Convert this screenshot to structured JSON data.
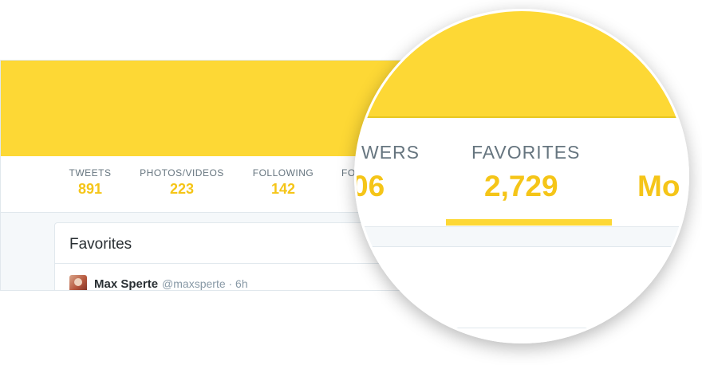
{
  "colors": {
    "banner": "#fdd835",
    "accent_value": "#f5c518",
    "label": "#66757f",
    "background": "#f5f8fa",
    "border": "#e1e8ed"
  },
  "profile_nav": {
    "items": [
      {
        "label": "TWEETS",
        "value": "891"
      },
      {
        "label": "PHOTOS/VIDEOS",
        "value": "223"
      },
      {
        "label": "FOLLOWING",
        "value": "142"
      },
      {
        "label": "FO",
        "value": ""
      }
    ]
  },
  "favorites_card": {
    "title": "Favorites",
    "tweet": {
      "avatar_icon": "user-avatar",
      "name": "Max Sperte",
      "meta": "@maxsperte · 6h"
    }
  },
  "magnifier": {
    "left_label": "WERS",
    "left_value": "06",
    "center_label": "FAVORITES",
    "center_value": "2,729",
    "right_value": "Mo"
  }
}
